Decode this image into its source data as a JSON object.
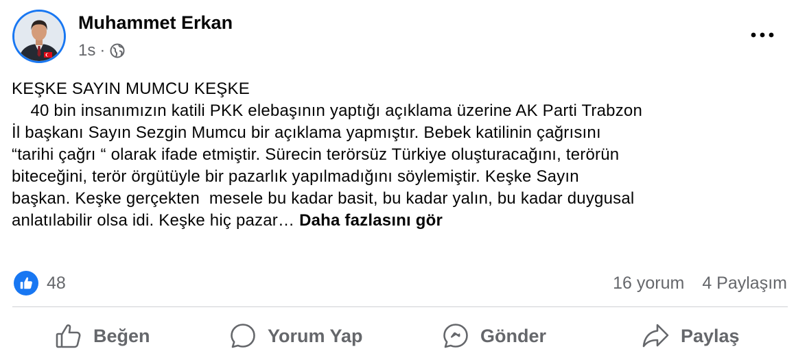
{
  "post": {
    "author": "Muhammet Erkan",
    "time": "1s",
    "separator": "·",
    "audience_icon": "globe-icon",
    "more_icon": "more-options-icon",
    "text_lines": [
      "KEŞKE SAYIN MUMCU KEŞKE",
      "    40 bin insanımızın katili PKK elebaşının yaptığı açıklama üzerine AK Parti Trabzon",
      "İl başkanı Sayın Sezgin Mumcu bir açıklama yapmıştır. Bebek katilinin çağrısını",
      "“tarihi çağrı “ olarak ifade etmiştir. Sürecin terörsüz Türkiye oluşturacağını, terörün",
      "biteceğini, terör örgütüyle bir pazarlık yapılmadığını söylemiştir. Keşke Sayın",
      "başkan. Keşke gerçekten  mesele bu kadar basit, bu kadar yalın, bu kadar duygusal",
      "anlatılabilir olsa idi. Keşke hiç pazar… "
    ],
    "see_more": "Daha fazlasını gör"
  },
  "engagement": {
    "reaction_icon": "like-reaction-icon",
    "reaction_count": "48",
    "comments": "16 yorum",
    "shares": "4 Paylaşım"
  },
  "actions": {
    "like": {
      "label": "Beğen",
      "icon": "thumbs-up-icon"
    },
    "comment": {
      "label": "Yorum Yap",
      "icon": "comment-bubble-icon"
    },
    "send": {
      "label": "Gönder",
      "icon": "messenger-icon"
    },
    "share": {
      "label": "Paylaş",
      "icon": "share-arrow-icon"
    }
  },
  "colors": {
    "accent": "#1877f2",
    "secondary_text": "#65676b",
    "primary_text": "#050505",
    "divider": "#ced0d4"
  }
}
